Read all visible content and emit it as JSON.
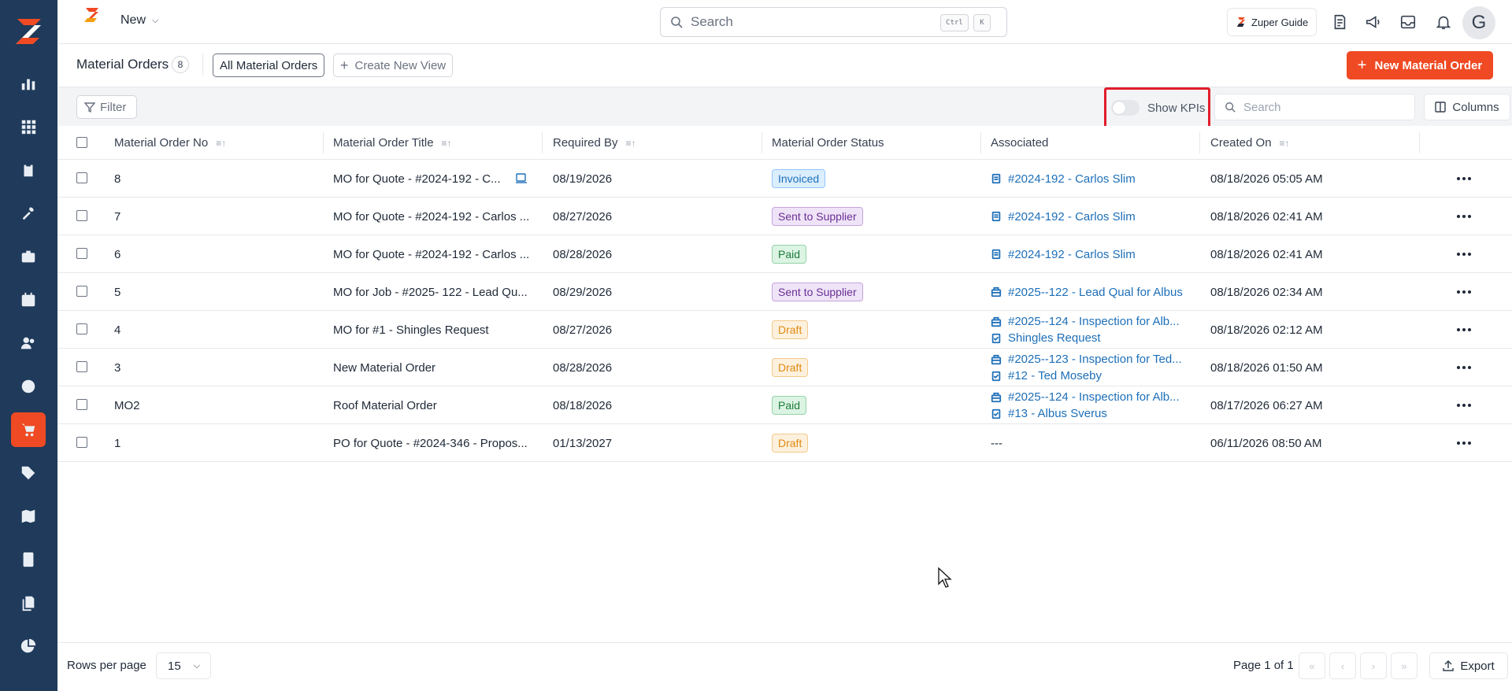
{
  "colors": {
    "accent": "#ef4a23",
    "sidebar": "#1f3a5a",
    "link": "#1d6fb8",
    "highlight": "#e11d2a"
  },
  "sidebar": {
    "items": [
      {
        "icon": "bar-chart-icon"
      },
      {
        "icon": "grid-icon"
      },
      {
        "icon": "clipboard-icon"
      },
      {
        "icon": "tools-icon"
      },
      {
        "icon": "briefcase-icon"
      },
      {
        "icon": "calendar-icon"
      },
      {
        "icon": "users-icon"
      },
      {
        "icon": "clock-icon"
      },
      {
        "icon": "cart-icon",
        "active": true
      },
      {
        "icon": "tag-icon"
      },
      {
        "icon": "map-icon"
      },
      {
        "icon": "calculator-icon"
      },
      {
        "icon": "documents-icon"
      },
      {
        "icon": "pie-chart-icon"
      }
    ]
  },
  "topbar": {
    "new_label": "New",
    "search_placeholder": "Search",
    "kbd_ctrl": "Ctrl",
    "kbd_k": "K",
    "guide_label": "Zuper Guide",
    "avatar_initial": "G"
  },
  "header": {
    "title": "Material Orders",
    "count": "8",
    "active_view": "All Material Orders",
    "create_view": "Create New View",
    "new_button": "New Material Order"
  },
  "toolbar": {
    "filter_label": "Filter",
    "kpi_label": "Show KPIs",
    "kpi_on": false,
    "search_placeholder": "Search",
    "columns_label": "Columns"
  },
  "table": {
    "columns": [
      "Material Order No",
      "Material Order Title",
      "Required By",
      "Material Order Status",
      "Associated",
      "Created On"
    ],
    "rows": [
      {
        "no": "8",
        "title": "MO for Quote - #2024-192 - C...",
        "required": "08/19/2026",
        "status": "Invoiced",
        "status_class": "b-invoiced",
        "assoc": [
          {
            "icon": "quote-icon",
            "text": "#2024-192 - Carlos Slim"
          }
        ],
        "created": "08/18/2026 05:05 AM",
        "has_doc_icon": true
      },
      {
        "no": "7",
        "title": "MO for Quote - #2024-192 - Carlos ...",
        "required": "08/27/2026",
        "status": "Sent to Supplier",
        "status_class": "b-sent",
        "assoc": [
          {
            "icon": "quote-icon",
            "text": "#2024-192 - Carlos Slim"
          }
        ],
        "created": "08/18/2026 02:41 AM"
      },
      {
        "no": "6",
        "title": "MO for Quote - #2024-192 - Carlos ...",
        "required": "08/28/2026",
        "status": "Paid",
        "status_class": "b-paid",
        "assoc": [
          {
            "icon": "quote-icon",
            "text": "#2024-192 - Carlos Slim"
          }
        ],
        "created": "08/18/2026 02:41 AM"
      },
      {
        "no": "5",
        "title": "MO for Job - #2025- 122 - Lead Qu...",
        "required": "08/29/2026",
        "status": "Sent to Supplier",
        "status_class": "b-sent",
        "assoc": [
          {
            "icon": "job-icon",
            "text": "#2025--122 - Lead Qual for Albus"
          }
        ],
        "created": "08/18/2026 02:34 AM"
      },
      {
        "no": "4",
        "title": "MO for #1 - Shingles Request",
        "required": "08/27/2026",
        "status": "Draft",
        "status_class": "b-draft",
        "assoc": [
          {
            "icon": "job-icon",
            "text": "#2025--124 - Inspection for Alb..."
          },
          {
            "icon": "request-icon",
            "text": "Shingles Request"
          }
        ],
        "created": "08/18/2026 02:12 AM"
      },
      {
        "no": "3",
        "title": "New Material Order",
        "required": "08/28/2026",
        "status": "Draft",
        "status_class": "b-draft",
        "assoc": [
          {
            "icon": "job-icon",
            "text": "#2025--123 - Inspection for Ted..."
          },
          {
            "icon": "request-icon",
            "text": "#12 - Ted Moseby"
          }
        ],
        "created": "08/18/2026 01:50 AM"
      },
      {
        "no": "MO2",
        "title": "Roof Material Order",
        "required": "08/18/2026",
        "status": "Paid",
        "status_class": "b-paid",
        "assoc": [
          {
            "icon": "job-icon",
            "text": "#2025--124 - Inspection for Alb..."
          },
          {
            "icon": "request-icon",
            "text": "#13 - Albus Sverus"
          }
        ],
        "created": "08/17/2026 06:27 AM"
      },
      {
        "no": "1",
        "title": "PO for Quote - #2024-346 - Propos...",
        "required": "01/13/2027",
        "status": "Draft",
        "status_class": "b-draft",
        "assoc": [],
        "assoc_empty": "---",
        "created": "06/11/2026 08:50 AM"
      }
    ]
  },
  "footer": {
    "rows_per_page_label": "Rows per page",
    "rows_per_page": "15",
    "page_info": "Page 1 of 1",
    "export_label": "Export"
  }
}
